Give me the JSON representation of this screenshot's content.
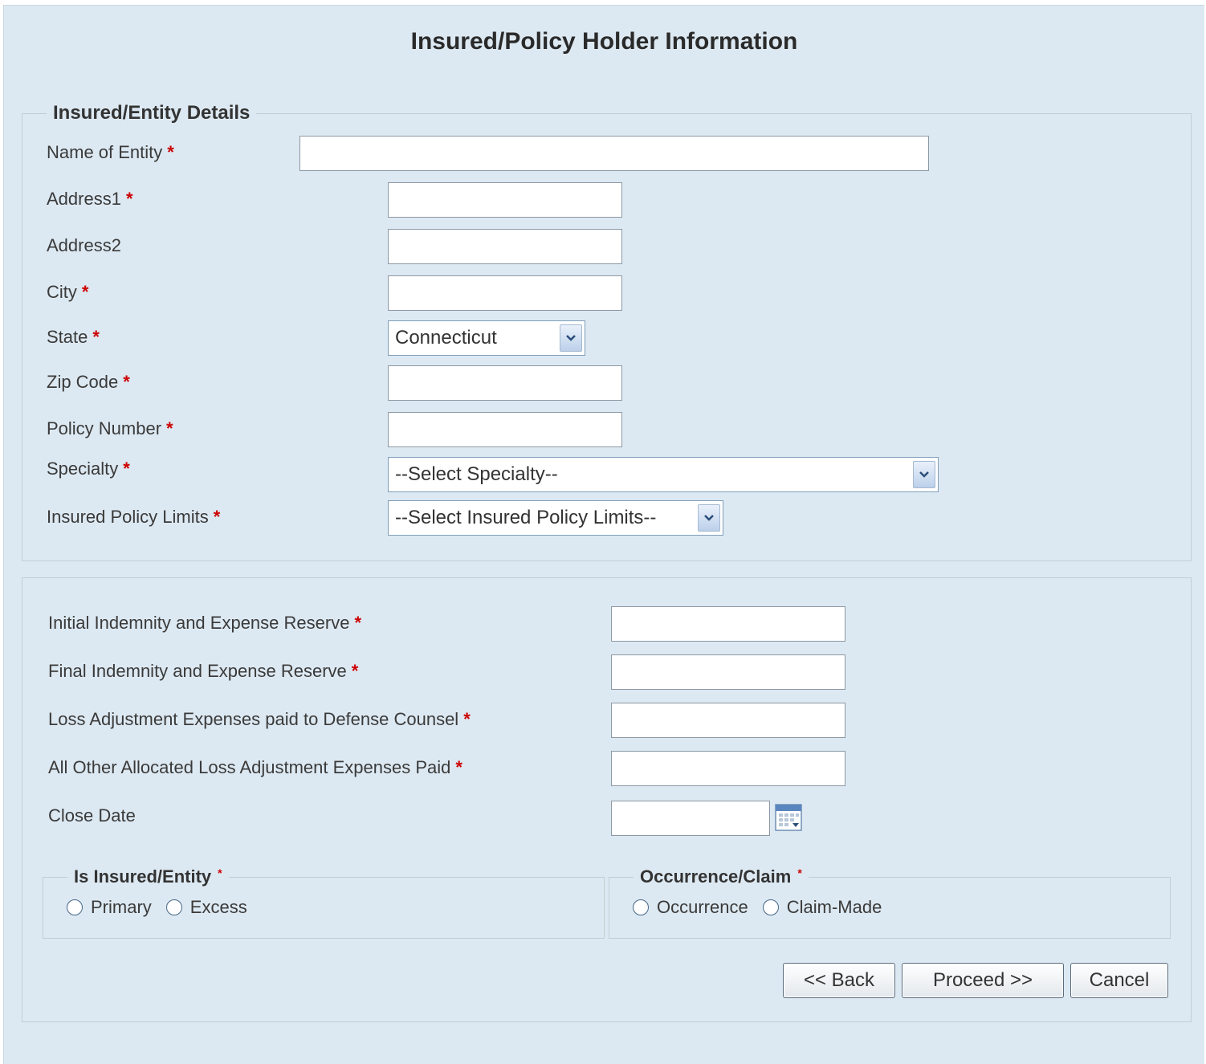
{
  "page": {
    "title": "Insured/Policy Holder Information"
  },
  "entity_section": {
    "legend": "Insured/Entity Details",
    "name_of_entity": {
      "label": "Name of Entity",
      "value": ""
    },
    "address1": {
      "label": "Address1",
      "value": ""
    },
    "address2": {
      "label": "Address2",
      "value": ""
    },
    "city": {
      "label": "City",
      "value": ""
    },
    "state": {
      "label": "State",
      "value": "Connecticut"
    },
    "zip_code": {
      "label": "Zip Code",
      "value": ""
    },
    "policy_number": {
      "label": "Policy Number",
      "value": ""
    },
    "specialty": {
      "label": "Specialty",
      "value": "--Select Specialty--"
    },
    "policy_limits": {
      "label": "Insured Policy Limits",
      "value": "--Select Insured Policy Limits--"
    }
  },
  "reserve_section": {
    "initial_reserve": {
      "label": "Initial Indemnity and Expense Reserve",
      "value": ""
    },
    "final_reserve": {
      "label": "Final Indemnity and Expense Reserve",
      "value": ""
    },
    "loss_adj_defense": {
      "label": "Loss Adjustment Expenses paid to Defense Counsel",
      "value": ""
    },
    "other_loss_adj": {
      "label": "All Other Allocated Loss Adjustment Expenses Paid",
      "value": ""
    },
    "close_date": {
      "label": "Close Date",
      "value": ""
    }
  },
  "insured_type": {
    "legend": "Is Insured/Entity",
    "options": [
      "Primary",
      "Excess"
    ]
  },
  "occurrence_claim": {
    "legend": "Occurrence/Claim",
    "options": [
      "Occurrence",
      "Claim-Made"
    ]
  },
  "buttons": {
    "back": "<< Back",
    "proceed": "Proceed >>",
    "cancel": "Cancel"
  },
  "required_marker": "*",
  "colors": {
    "background": "#dde9f2",
    "required": "#cc0000",
    "border": "#c3ccd3"
  },
  "icons": {
    "select_arrow": "chevron-down-icon",
    "calendar": "calendar-icon"
  }
}
